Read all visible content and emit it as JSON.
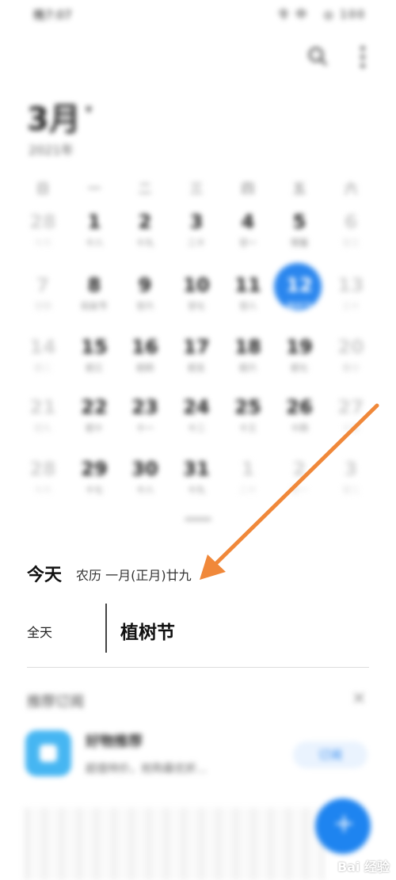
{
  "status_bar": {
    "time": "晚7:07",
    "indicators": "令 中   ◎ 100"
  },
  "header": {
    "month": "3月",
    "month_dropdown": "▾",
    "year": "2021年"
  },
  "weekdays": [
    "日",
    "一",
    "二",
    "三",
    "四",
    "五",
    "六"
  ],
  "calendar": {
    "rows": [
      [
        {
          "n": "28",
          "s": "十六",
          "f": true
        },
        {
          "n": "1",
          "s": "十八"
        },
        {
          "n": "2",
          "s": "十九"
        },
        {
          "n": "3",
          "s": "二十"
        },
        {
          "n": "4",
          "s": "廿一"
        },
        {
          "n": "5",
          "s": "惊蛰"
        },
        {
          "n": "6",
          "s": "廿三",
          "f": true
        }
      ],
      [
        {
          "n": "7",
          "s": "廿四",
          "f": true
        },
        {
          "n": "8",
          "s": "妇女节"
        },
        {
          "n": "9",
          "s": "廿六"
        },
        {
          "n": "10",
          "s": "廿七"
        },
        {
          "n": "11",
          "s": "廿八"
        },
        {
          "n": "12",
          "s": "植树节",
          "t": true
        },
        {
          "n": "13",
          "s": "三十",
          "f": true
        }
      ],
      [
        {
          "n": "14",
          "s": "初二",
          "f": true
        },
        {
          "n": "15",
          "s": "初三"
        },
        {
          "n": "16",
          "s": "初四"
        },
        {
          "n": "17",
          "s": "初五"
        },
        {
          "n": "18",
          "s": "初六"
        },
        {
          "n": "19",
          "s": "初七"
        },
        {
          "n": "20",
          "s": "春分",
          "f": true
        }
      ],
      [
        {
          "n": "21",
          "s": "初九",
          "f": true
        },
        {
          "n": "22",
          "s": "初十"
        },
        {
          "n": "23",
          "s": "十一"
        },
        {
          "n": "24",
          "s": "十二"
        },
        {
          "n": "25",
          "s": "十三"
        },
        {
          "n": "26",
          "s": "十四"
        },
        {
          "n": "27",
          "s": "十五",
          "f": true
        }
      ],
      [
        {
          "n": "28",
          "s": "十六",
          "f": true
        },
        {
          "n": "29",
          "s": "十七"
        },
        {
          "n": "30",
          "s": "十八"
        },
        {
          "n": "31",
          "s": "十九"
        },
        {
          "n": "1",
          "s": "二十",
          "f": true
        },
        {
          "n": "2",
          "s": "廿一",
          "f": true
        },
        {
          "n": "3",
          "s": "廿二",
          "f": true
        }
      ]
    ]
  },
  "today": {
    "title": "今天",
    "lunar": "农历 一月(正月)廿九",
    "event_time": "全天",
    "event_title": "植树节"
  },
  "recommended": {
    "title": "推荐订阅",
    "app_name": "好物推荐",
    "app_desc": "超值特价，抢购最优折...",
    "subscribe": "订阅"
  },
  "fab_symbol": "+",
  "watermark": "Bai 经验",
  "colors": {
    "accent": "#2a86ee",
    "arrow": "#f0883a",
    "app_icon": "#46b6f2"
  },
  "icons": [
    "search-icon",
    "more-icon",
    "close-icon",
    "add-icon",
    "arrow-annotation"
  ]
}
